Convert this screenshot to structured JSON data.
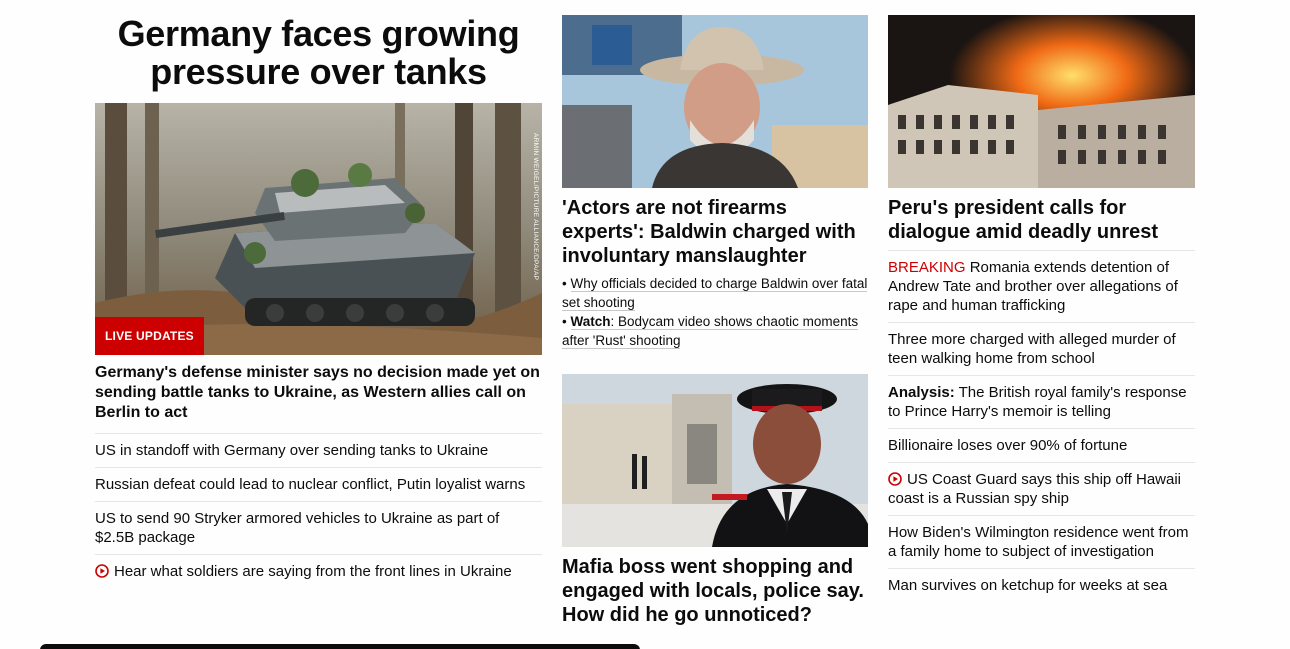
{
  "main": {
    "headline": "Germany faces growing pressure over tanks",
    "image_credit": "ARMIN WEIGEL/PICTURE ALLIANCE/DPA/AP",
    "badge": "LIVE UPDATES",
    "lead": "Germany's defense minister says no decision made yet on sending battle tanks to Ukraine, as Western allies call on Berlin to act",
    "stories": [
      "US in standoff with Germany over sending tanks to Ukraine",
      "Russian defeat could lead to nuclear conflict, Putin loyalist warns",
      "US to send 90 Stryker armored vehicles to Ukraine as part of $2.5B package",
      "Hear what soldiers are saying from the front lines in Ukraine"
    ]
  },
  "middle": {
    "baldwin_headline": "'Actors are not firearms experts': Baldwin charged with involuntary manslaughter",
    "baldwin_links": [
      {
        "bullet": "•",
        "prefix": "",
        "text": "Why officials decided to charge Baldwin over fatal set shooting"
      },
      {
        "bullet": "•",
        "prefix": "Watch",
        "text": ": Bodycam video shows chaotic moments after 'Rust' shooting"
      }
    ],
    "mafia_headline": "Mafia boss went shopping and engaged with locals, police say. How did he go unnoticed?"
  },
  "right": {
    "peru_headline": "Peru's president calls for dialogue amid deadly unrest",
    "stories": [
      {
        "label": "BREAKING",
        "text": " Romania extends detention of Andrew Tate and brother over allegations of rape and human trafficking"
      },
      {
        "label": "",
        "text": "Three more charged with alleged murder of teen walking home from school"
      },
      {
        "label": "Analysis:",
        "text": " The British royal family's response to Prince Harry's memoir is telling"
      },
      {
        "label": "",
        "text": "Billionaire loses over 90% of fortune"
      },
      {
        "label": "",
        "text": "US Coast Guard says this ship off Hawaii coast is a Russian spy ship"
      },
      {
        "label": "",
        "text": "How Biden's Wilmington residence went from a family home to subject of investigation"
      },
      {
        "label": "",
        "text": "Man survives on ketchup for weeks at sea"
      }
    ]
  },
  "colors": {
    "accent": "#cc0000",
    "text": "#0c0c0c",
    "divider": "#e6e6e6"
  }
}
